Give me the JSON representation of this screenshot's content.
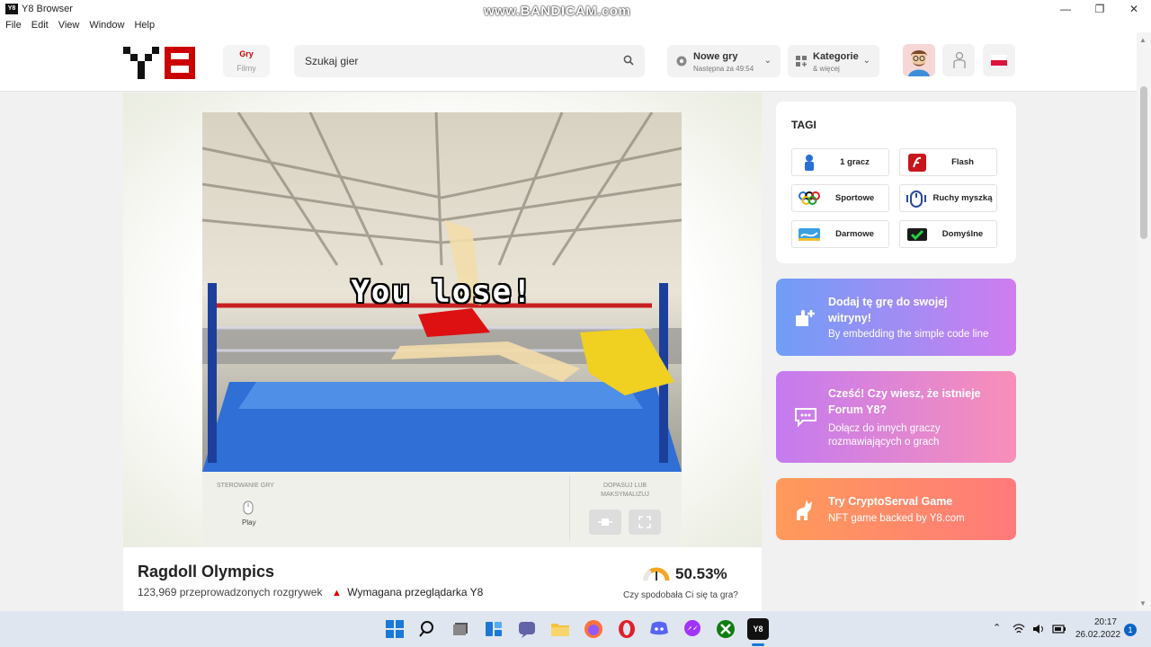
{
  "window": {
    "title": "Y8 Browser",
    "app_icon": "Y8",
    "watermark": "www.BANDICAM.com",
    "menu": [
      "File",
      "Edit",
      "View",
      "Window",
      "Help"
    ]
  },
  "header": {
    "tab_active": "Gry",
    "tab_inactive": "Filmy",
    "search_placeholder": "Szukaj gier",
    "new_games_title": "Nowe gry",
    "new_games_sub": "Następna za 49:54",
    "categories_title": "Kategorie",
    "categories_sub": "& więcej"
  },
  "game": {
    "overlay_text": "You lose!",
    "controls_label": "STEROWANIE GRY",
    "control_play": "Play",
    "fit_label_1": "DOPASUJ LUB",
    "fit_label_2": "MAKSYMALIZUJ",
    "title": "Ragdoll Olympics",
    "plays": "123,969 przeprowadzonych rozgrywek",
    "warning": "Wymagana przeglądarka Y8",
    "rating": "50.53%",
    "rating_question": "Czy spodobała Ci się ta gra?"
  },
  "tags": {
    "heading": "TAGI",
    "items": [
      {
        "label": "1 gracz",
        "icon": "player-icon"
      },
      {
        "label": "Flash",
        "icon": "flash-icon"
      },
      {
        "label": "Sportowe",
        "icon": "olympic-rings-icon"
      },
      {
        "label": "Ruchy myszką",
        "icon": "mouse-movement-icon"
      },
      {
        "label": "Darmowe",
        "icon": "free-icon"
      },
      {
        "label": "Domyślne",
        "icon": "default-icon"
      }
    ]
  },
  "promos": [
    {
      "line1": "Dodaj tę grę do swojej",
      "line2": "witryny!",
      "line3": "By embedding the simple code line",
      "icon": "puzzle-add-icon"
    },
    {
      "line1": "Cześć! Czy wiesz, że istnieje",
      "line2": "Forum Y8?",
      "line3": "Dołącz do innych graczy",
      "line4": "rozmawiających o grach",
      "icon": "chat-bubbles-icon"
    },
    {
      "line1": "Try CryptoServal Game",
      "line2": "NFT game backed by Y8.com",
      "icon": "serval-cat-icon"
    }
  ],
  "taskbar": {
    "time": "20:17",
    "date": "26.02.2022",
    "notifications": "1"
  },
  "colors": {
    "brand_red": "#cc0000",
    "promo1_start": "#6f9ef7",
    "promo1_end": "#d07cf0",
    "promo2_start": "#c47bf0",
    "promo2_end": "#f98fb8",
    "promo3_start": "#ff9a5a",
    "promo3_end": "#ff7a7a"
  }
}
